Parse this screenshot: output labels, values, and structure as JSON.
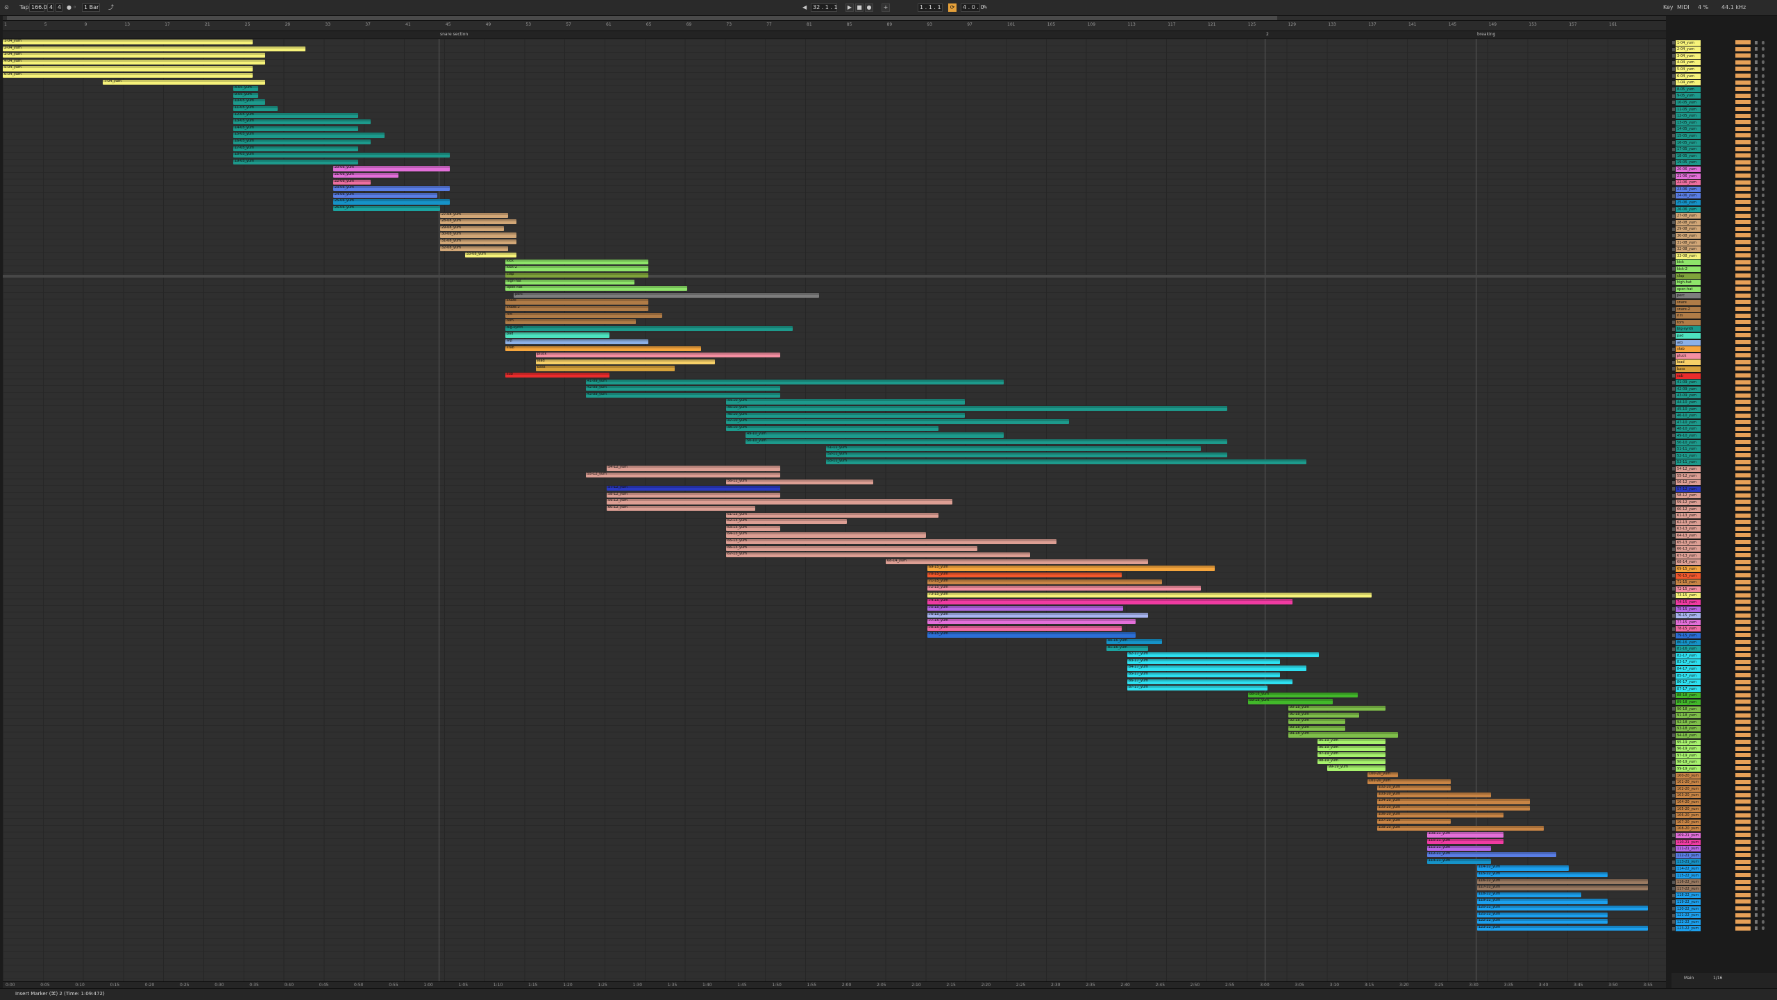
{
  "transport": {
    "tap_label": "Tap",
    "tempo": "166.00",
    "sig_num": "4",
    "sig_den": "4",
    "bar_label": "1 Bar",
    "position": "32 . 1 . 1",
    "loop_start": "1 . 1 . 1",
    "loop_len": "4 . 0 . 0",
    "key_label": "Key",
    "midi_label": "MIDI",
    "cpu": "4 %",
    "sample_rate": "44.1 kHz"
  },
  "locators": [
    {
      "label": "snare section"
    },
    {
      "label": "2"
    },
    {
      "label": "breaking"
    }
  ],
  "bar_numbers": [
    "1",
    "5",
    "9",
    "13",
    "17",
    "21",
    "25",
    "29",
    "33",
    "37",
    "41",
    "45",
    "49",
    "53",
    "57",
    "61",
    "65",
    "69",
    "73",
    "77",
    "81",
    "85",
    "89",
    "93",
    "97",
    "101",
    "105",
    "109",
    "113",
    "117",
    "121",
    "125",
    "129",
    "133",
    "137",
    "141",
    "145",
    "149",
    "153",
    "157",
    "161"
  ],
  "time_labels": [
    "0:00",
    "0:05",
    "0:10",
    "0:15",
    "0:20",
    "0:25",
    "0:30",
    "0:35",
    "0:40",
    "0:45",
    "0:50",
    "0:55",
    "1:00",
    "1:05",
    "1:10",
    "1:15",
    "1:20",
    "1:25",
    "1:30",
    "1:35",
    "1:40",
    "1:45",
    "1:50",
    "1:55",
    "2:00",
    "2:05",
    "2:10",
    "2:15",
    "2:20",
    "2:25",
    "2:30",
    "2:35",
    "2:40",
    "2:45",
    "2:50",
    "2:55",
    "3:00",
    "3:05",
    "3:10",
    "3:15",
    "3:20",
    "3:25",
    "3:30",
    "3:35",
    "3:40",
    "3:45",
    "3:50",
    "3:55",
    "4:00"
  ],
  "footer": {
    "status_text": "Insert Marker (⌘) 2 (Time: 1:09:472)",
    "main_label": "Main",
    "draw_label": "1/16"
  },
  "tracks": [
    {
      "name": "1-04_yum",
      "color": "#f7f37a",
      "clip": [
        0,
        360
      ]
    },
    {
      "name": "2-04_yum",
      "color": "#f7f37a",
      "clip": [
        0,
        436
      ]
    },
    {
      "name": "3-04_yum",
      "color": "#f7f37a",
      "clip": [
        0,
        378
      ]
    },
    {
      "name": "4-04_yum",
      "color": "#f7f37a",
      "clip": [
        0,
        378
      ]
    },
    {
      "name": "5-04_yum",
      "color": "#f7f37a",
      "clip": [
        0,
        360
      ]
    },
    {
      "name": "6-04_yum",
      "color": "#f7f37a",
      "clip": [
        0,
        360
      ]
    },
    {
      "name": "7-04_yum",
      "color": "#f7f37a",
      "clip": [
        144,
        378
      ]
    },
    {
      "name": "8-05_yum",
      "color": "#1d9a8c",
      "clip": [
        332,
        368
      ]
    },
    {
      "name": "9-05_yum",
      "color": "#1d9a8c",
      "clip": [
        332,
        368
      ]
    },
    {
      "name": "10-05_yum",
      "color": "#1d9a8c",
      "clip": [
        332,
        378
      ]
    },
    {
      "name": "11-05_yum",
      "color": "#1d9a8c",
      "clip": [
        332,
        396
      ]
    },
    {
      "name": "12-05_yum",
      "color": "#1d9a8c",
      "clip": [
        332,
        512
      ]
    },
    {
      "name": "13-05_yum",
      "color": "#1d9a8c",
      "clip": [
        332,
        530
      ]
    },
    {
      "name": "14-05_yum",
      "color": "#1d9a8c",
      "clip": [
        332,
        512
      ]
    },
    {
      "name": "15-05_yum",
      "color": "#1d9a8c",
      "clip": [
        332,
        550
      ]
    },
    {
      "name": "16-05_yum",
      "color": "#1d9a8c",
      "clip": [
        332,
        530
      ]
    },
    {
      "name": "17-05_yum",
      "color": "#1d9a8c",
      "clip": [
        332,
        512
      ]
    },
    {
      "name": "18-05_yum",
      "color": "#1d9a8c",
      "clip": [
        332,
        644
      ]
    },
    {
      "name": "19-05_yum",
      "color": "#1d9a8c",
      "clip": [
        332,
        512
      ]
    },
    {
      "name": "20-06_yum",
      "color": "#e36fd9",
      "clip": [
        476,
        644
      ]
    },
    {
      "name": "21-06_yum",
      "color": "#e36fd9",
      "clip": [
        476,
        570
      ]
    },
    {
      "name": "22-06_yum",
      "color": "#ee6fa0",
      "clip": [
        476,
        530
      ]
    },
    {
      "name": "23-06_yum",
      "color": "#5a7ee6",
      "clip": [
        476,
        644
      ]
    },
    {
      "name": "24-06_yum",
      "color": "#5a7ee6",
      "clip": [
        476,
        626
      ]
    },
    {
      "name": "25-06_yum",
      "color": "#1693c8",
      "clip": [
        476,
        644
      ]
    },
    {
      "name": "26-06_yum",
      "color": "#1ba3a0",
      "clip": [
        476,
        630
      ]
    },
    {
      "name": "27-08_yum",
      "color": "#d2a777",
      "clip": [
        630,
        728
      ]
    },
    {
      "name": "28-08_yum",
      "color": "#d2a777",
      "clip": [
        630,
        740
      ]
    },
    {
      "name": "29-08_yum",
      "color": "#d2a777",
      "clip": [
        630,
        722
      ]
    },
    {
      "name": "30-08_yum",
      "color": "#d2a777",
      "clip": [
        630,
        740
      ]
    },
    {
      "name": "31-08_yum",
      "color": "#d2a777",
      "clip": [
        630,
        740
      ]
    },
    {
      "name": "32-08_yum",
      "color": "#d2a777",
      "clip": [
        630,
        728
      ]
    },
    {
      "name": "33-08_yum",
      "color": "#f7f37a",
      "clip": [
        666,
        740
      ]
    },
    {
      "name": "kick",
      "color": "#8ee56a",
      "clip": [
        724,
        930
      ]
    },
    {
      "name": "kick-2",
      "color": "#8ee56a",
      "clip": [
        724,
        930
      ]
    },
    {
      "name": "clap",
      "color": "#7fa33a",
      "clip": [
        724,
        930
      ]
    },
    {
      "name": "high-hat",
      "color": "#8ee56a",
      "clip": [
        724,
        910
      ]
    },
    {
      "name": "open-hat",
      "color": "#8ee56a",
      "clip": [
        724,
        986
      ]
    },
    {
      "name": "perc",
      "color": "#7d7d7d",
      "clip": [
        736,
        1176
      ]
    },
    {
      "name": "snare",
      "color": "#b07c47",
      "clip": [
        724,
        930
      ]
    },
    {
      "name": "snare-2",
      "color": "#b07c47",
      "clip": [
        724,
        930
      ]
    },
    {
      "name": "rim",
      "color": "#b07c47",
      "clip": [
        724,
        950
      ]
    },
    {
      "name": "tom",
      "color": "#b07c47",
      "clip": [
        724,
        912
      ]
    },
    {
      "name": "big-synth",
      "color": "#1d9a8c",
      "clip": [
        724,
        1138
      ]
    },
    {
      "name": "pad",
      "color": "#4de2bf",
      "clip": [
        724,
        874
      ]
    },
    {
      "name": "arp",
      "color": "#8db1e6",
      "clip": [
        724,
        930
      ]
    },
    {
      "name": "stab",
      "color": "#f6a63d",
      "clip": [
        724,
        1006
      ]
    },
    {
      "name": "pluck",
      "color": "#f58fa2",
      "clip": [
        768,
        1120
      ]
    },
    {
      "name": "lead",
      "color": "#f7d068",
      "clip": [
        768,
        1026
      ]
    },
    {
      "name": "bass",
      "color": "#d8a23b",
      "clip": [
        768,
        968
      ]
    },
    {
      "name": "sub",
      "color": "#ea2c2c",
      "clip": [
        724,
        874
      ]
    },
    {
      "name": "41-09_yum",
      "color": "#1d9a8c",
      "clip": [
        840,
        1442
      ]
    },
    {
      "name": "42-09_yum",
      "color": "#1d9a8c",
      "clip": [
        840,
        1120
      ]
    },
    {
      "name": "43-09_yum",
      "color": "#1d9a8c",
      "clip": [
        840,
        1120
      ]
    },
    {
      "name": "44-10_yum",
      "color": "#1d9a8c",
      "clip": [
        1042,
        1386
      ]
    },
    {
      "name": "45-10_yum",
      "color": "#1d9a8c",
      "clip": [
        1042,
        1764
      ]
    },
    {
      "name": "46-10_yum",
      "color": "#1d9a8c",
      "clip": [
        1042,
        1386
      ]
    },
    {
      "name": "47-10_yum",
      "color": "#1d9a8c",
      "clip": [
        1042,
        1536
      ]
    },
    {
      "name": "48-10_yum",
      "color": "#1d9a8c",
      "clip": [
        1042,
        1348
      ]
    },
    {
      "name": "49-10_yum",
      "color": "#1d9a8c",
      "clip": [
        1070,
        1442
      ]
    },
    {
      "name": "50-10_yum",
      "color": "#1d9a8c",
      "clip": [
        1070,
        1764
      ]
    },
    {
      "name": "51-11_yum",
      "color": "#1d9a8c",
      "clip": [
        1186,
        1726
      ]
    },
    {
      "name": "52-11_yum",
      "color": "#1d9a8c",
      "clip": [
        1186,
        1764
      ]
    },
    {
      "name": "53-11_yum",
      "color": "#1d9a8c",
      "clip": [
        1186,
        1878
      ]
    },
    {
      "name": "54-12_yum",
      "color": "#dd9f94",
      "clip": [
        870,
        1120
      ]
    },
    {
      "name": "55-12_yum",
      "color": "#dd9f94",
      "clip": [
        840,
        1120
      ]
    },
    {
      "name": "56-12_yum",
      "color": "#dd9f94",
      "clip": [
        1042,
        1254
      ]
    },
    {
      "name": "57-12_yum",
      "color": "#2a3ac4",
      "clip": [
        870,
        1120
      ]
    },
    {
      "name": "58-12_yum",
      "color": "#dd9f94",
      "clip": [
        870,
        1120
      ]
    },
    {
      "name": "59-12_yum",
      "color": "#dd9f94",
      "clip": [
        870,
        1368
      ]
    },
    {
      "name": "60-12_yum",
      "color": "#dd9f94",
      "clip": [
        870,
        1084
      ]
    },
    {
      "name": "61-13_yum",
      "color": "#dd9f94",
      "clip": [
        1042,
        1348
      ]
    },
    {
      "name": "62-13_yum",
      "color": "#dd9f94",
      "clip": [
        1042,
        1216
      ]
    },
    {
      "name": "63-13_yum",
      "color": "#dd9f94",
      "clip": [
        1042,
        1120
      ]
    },
    {
      "name": "64-13_yum",
      "color": "#dd9f94",
      "clip": [
        1042,
        1330
      ]
    },
    {
      "name": "65-13_yum",
      "color": "#dd9f94",
      "clip": [
        1042,
        1518
      ]
    },
    {
      "name": "66-13_yum",
      "color": "#dd9f94",
      "clip": [
        1042,
        1404
      ]
    },
    {
      "name": "67-13_yum",
      "color": "#dd9f94",
      "clip": [
        1042,
        1480
      ]
    },
    {
      "name": "68-14_yum",
      "color": "#dd9f94",
      "clip": [
        1272,
        1650
      ]
    },
    {
      "name": "69-15_yum",
      "color": "#f6a63d",
      "clip": [
        1332,
        1746
      ]
    },
    {
      "name": "70-15_yum",
      "color": "#f4582c",
      "clip": [
        1332,
        1612
      ]
    },
    {
      "name": "71-15_yum",
      "color": "#c98545",
      "clip": [
        1332,
        1670
      ]
    },
    {
      "name": "72-15_yum",
      "color": "#f58fa2",
      "clip": [
        1332,
        1726
      ]
    },
    {
      "name": "73-15_yum",
      "color": "#f7f37a",
      "clip": [
        1332,
        1972
      ]
    },
    {
      "name": "74-15_yum",
      "color": "#f03ba2",
      "clip": [
        1332,
        1858
      ]
    },
    {
      "name": "75-15_yum",
      "color": "#b667e6",
      "clip": [
        1332,
        1614
      ]
    },
    {
      "name": "76-15_yum",
      "color": "#a9b6f2",
      "clip": [
        1332,
        1650
      ]
    },
    {
      "name": "77-15_yum",
      "color": "#e36fd9",
      "clip": [
        1332,
        1632
      ]
    },
    {
      "name": "78-15_yum",
      "color": "#f26aa5",
      "clip": [
        1332,
        1612
      ]
    },
    {
      "name": "79-15_yum",
      "color": "#2b6fd6",
      "clip": [
        1332,
        1632
      ]
    },
    {
      "name": "80-16_yum",
      "color": "#1693c8",
      "clip": [
        1590,
        1670
      ]
    },
    {
      "name": "81-16_yum",
      "color": "#1ba3a0",
      "clip": [
        1590,
        1650
      ]
    },
    {
      "name": "82-17_yum",
      "color": "#2ee0f0",
      "clip": [
        1620,
        1896
      ]
    },
    {
      "name": "83-17_yum",
      "color": "#2ee0f0",
      "clip": [
        1620,
        1840
      ]
    },
    {
      "name": "84-17_yum",
      "color": "#2ee0f0",
      "clip": [
        1620,
        1878
      ]
    },
    {
      "name": "85-17_yum",
      "color": "#2ee0f0",
      "clip": [
        1620,
        1840
      ]
    },
    {
      "name": "86-17_yum",
      "color": "#2ee0f0",
      "clip": [
        1620,
        1858
      ]
    },
    {
      "name": "87-17_yum",
      "color": "#2ee0f0",
      "clip": [
        1620,
        1822
      ]
    },
    {
      "name": "88-18_yum",
      "color": "#42b82a",
      "clip": [
        1794,
        1952
      ]
    },
    {
      "name": "89-18_yum",
      "color": "#42b82a",
      "clip": [
        1794,
        1916
      ]
    },
    {
      "name": "90-18_yum",
      "color": "#7fbf4a",
      "clip": [
        1852,
        1992
      ]
    },
    {
      "name": "91-18_yum",
      "color": "#7fbf4a",
      "clip": [
        1852,
        1954
      ]
    },
    {
      "name": "92-18_yum",
      "color": "#7fbf4a",
      "clip": [
        1852,
        1934
      ]
    },
    {
      "name": "93-18_yum",
      "color": "#7fbf4a",
      "clip": [
        1852,
        1934
      ]
    },
    {
      "name": "94-18_yum",
      "color": "#7fbf4a",
      "clip": [
        1852,
        2010
      ]
    },
    {
      "name": "95-19_yum",
      "color": "#a7f26d",
      "clip": [
        1894,
        1992
      ]
    },
    {
      "name": "96-19_yum",
      "color": "#a7f26d",
      "clip": [
        1894,
        1992
      ]
    },
    {
      "name": "97-19_yum",
      "color": "#a7f26d",
      "clip": [
        1894,
        1992
      ]
    },
    {
      "name": "98-19_yum",
      "color": "#a7f26d",
      "clip": [
        1894,
        1992
      ]
    },
    {
      "name": "99-19_yum",
      "color": "#a7f26d",
      "clip": [
        1908,
        1992
      ]
    },
    {
      "name": "100-20_yum",
      "color": "#c98545",
      "clip": [
        1966,
        2010
      ]
    },
    {
      "name": "101-20_yum",
      "color": "#c98545",
      "clip": [
        1966,
        2086
      ]
    },
    {
      "name": "102-20_yum",
      "color": "#c98545",
      "clip": [
        1980,
        2086
      ]
    },
    {
      "name": "103-20_yum",
      "color": "#c98545",
      "clip": [
        1980,
        2144
      ]
    },
    {
      "name": "104-20_yum",
      "color": "#c98545",
      "clip": [
        1980,
        2200
      ]
    },
    {
      "name": "105-20_yum",
      "color": "#c98545",
      "clip": [
        1980,
        2200
      ]
    },
    {
      "name": "106-20_yum",
      "color": "#c98545",
      "clip": [
        1980,
        2162
      ]
    },
    {
      "name": "107-20_yum",
      "color": "#c98545",
      "clip": [
        1980,
        2086
      ]
    },
    {
      "name": "108-20_yum",
      "color": "#c98545",
      "clip": [
        1980,
        2220
      ]
    },
    {
      "name": "109-21_yum",
      "color": "#e36fd9",
      "clip": [
        2052,
        2162
      ]
    },
    {
      "name": "110-21_yum",
      "color": "#f03ba2",
      "clip": [
        2052,
        2162
      ]
    },
    {
      "name": "111-21_yum",
      "color": "#b667e6",
      "clip": [
        2052,
        2144
      ]
    },
    {
      "name": "112-21_yum",
      "color": "#5a7ee6",
      "clip": [
        2052,
        2238
      ]
    },
    {
      "name": "113-21_yum",
      "color": "#1693c8",
      "clip": [
        2052,
        2144
      ]
    },
    {
      "name": "114-22_yum",
      "color": "#1ca0ee",
      "clip": [
        2124,
        2256
      ]
    },
    {
      "name": "115-22_yum",
      "color": "#1ca0ee",
      "clip": [
        2124,
        2312
      ]
    },
    {
      "name": "116-22_yum",
      "color": "#9b7b62",
      "clip": [
        2124,
        2370
      ]
    },
    {
      "name": "117-22_yum",
      "color": "#9b7b62",
      "clip": [
        2124,
        2370
      ]
    },
    {
      "name": "118-22_yum",
      "color": "#1ca0ee",
      "clip": [
        2124,
        2274
      ]
    },
    {
      "name": "119-22_yum",
      "color": "#1ca0ee",
      "clip": [
        2124,
        2312
      ]
    },
    {
      "name": "120-22_yum",
      "color": "#1ca0ee",
      "clip": [
        2124,
        2370
      ]
    },
    {
      "name": "121-22_yum",
      "color": "#1ca0ee",
      "clip": [
        2124,
        2312
      ]
    },
    {
      "name": "122-22_yum",
      "color": "#1ca0ee",
      "clip": [
        2124,
        2312
      ]
    },
    {
      "name": "123-22_yum",
      "color": "#1ca0ee",
      "clip": [
        2124,
        2370
      ]
    }
  ]
}
